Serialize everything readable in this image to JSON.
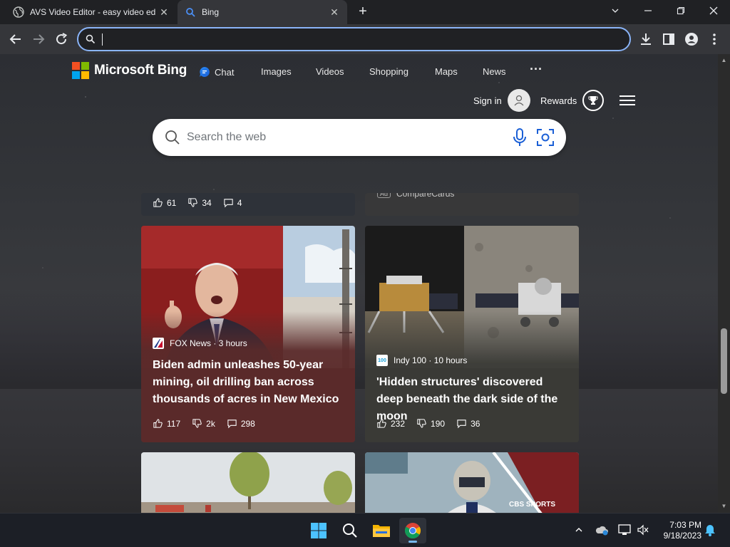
{
  "browser": {
    "tabs": [
      {
        "title": "AVS Video Editor - easy video ed",
        "favicon": "globe-icon",
        "active": false
      },
      {
        "title": "Bing",
        "favicon": "bing-search-icon",
        "active": true
      }
    ],
    "new_tab_symbol": "+",
    "address_bar": {
      "value": "",
      "placeholder": ""
    },
    "colors": {
      "tabbar": "#202124",
      "toolbar": "#35363a",
      "focus_ring": "#8ab4f8"
    }
  },
  "bing": {
    "brand": "Microsoft Bing",
    "nav": [
      {
        "label": "Chat"
      },
      {
        "label": "Images"
      },
      {
        "label": "Videos"
      },
      {
        "label": "Shopping"
      },
      {
        "label": "Maps"
      },
      {
        "label": "News"
      }
    ],
    "more_symbol": "···",
    "sign_in": "Sign in",
    "rewards": "Rewards",
    "search_placeholder": "Search the web"
  },
  "feed": {
    "top_left_metrics": {
      "likes": "61",
      "dislikes": "34",
      "comments": "4"
    },
    "top_right_ad": {
      "tag": "Ad",
      "source": "CompareCards"
    },
    "cards": [
      {
        "source": "FOX News · 3 hours",
        "headline": "Biden admin unleashes 50-year mining, oil drilling ban across thousands of acres in New Mexico",
        "likes": "117",
        "dislikes": "2k",
        "comments": "298",
        "accent": "#5a2a2a"
      },
      {
        "source": "Indy 100 · 10 hours",
        "source_logo": "100",
        "headline": "'Hidden structures' discovered deep beneath the dark side of the moon",
        "likes": "232",
        "dislikes": "190",
        "comments": "36",
        "accent": "#3a3a36"
      }
    ],
    "bottom_right_overlay": "CBS SPORTS"
  },
  "taskbar": {
    "apps": [
      "windows-start-icon",
      "search-icon",
      "file-explorer-icon",
      "chrome-icon"
    ],
    "time": "7:03 PM",
    "date": "9/18/2023"
  }
}
